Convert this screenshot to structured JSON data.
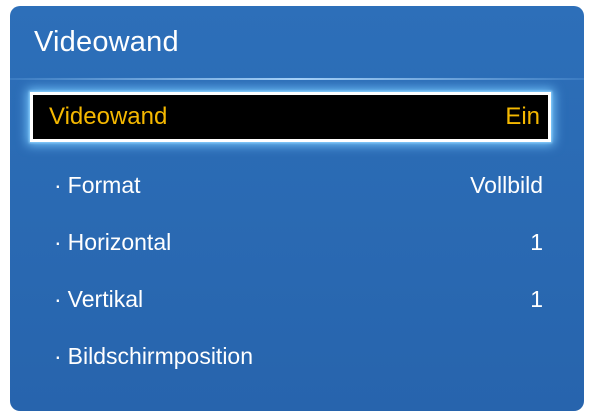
{
  "menu": {
    "title": "Videowand",
    "items": [
      {
        "label": "Videowand",
        "value": "Ein",
        "selected": true,
        "bullet": ""
      },
      {
        "label": "Format",
        "value": "Vollbild",
        "selected": false,
        "bullet": "·"
      },
      {
        "label": "Horizontal",
        "value": "1",
        "selected": false,
        "bullet": "·"
      },
      {
        "label": "Vertikal",
        "value": "1",
        "selected": false,
        "bullet": "·"
      },
      {
        "label": "Bildschirmposition",
        "value": "",
        "selected": false,
        "bullet": "·"
      }
    ]
  },
  "colors": {
    "panel": "#2a6ab3",
    "selected_bg": "#000000",
    "selected_text": "#f5b800",
    "selected_glow": "#78c8ff",
    "text": "#ffffff"
  }
}
